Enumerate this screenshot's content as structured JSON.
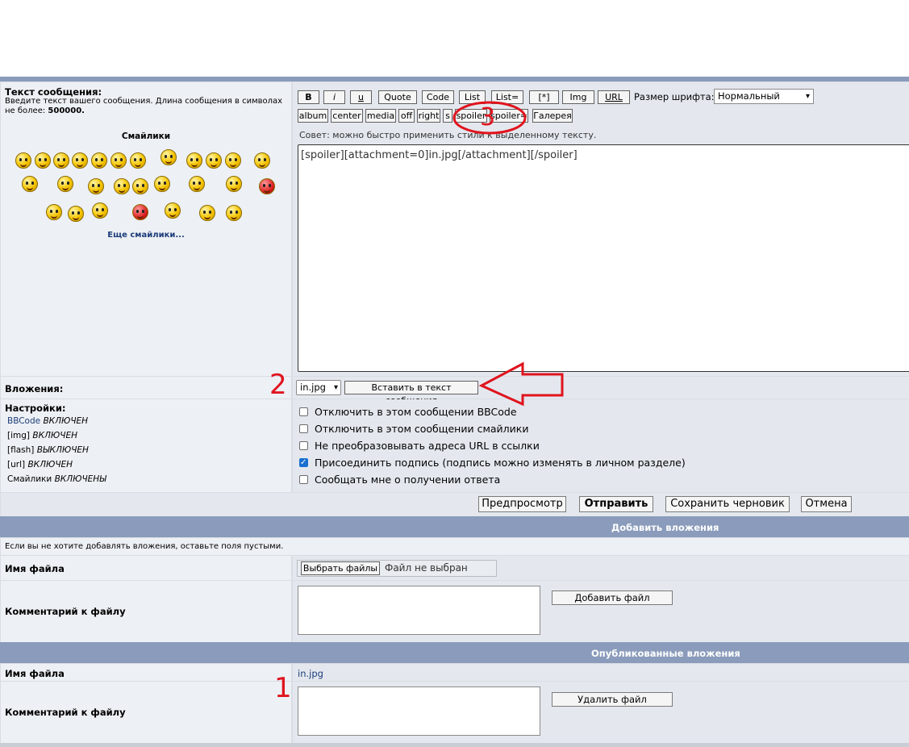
{
  "message": {
    "label": "Текст сообщения:",
    "desc": "Введите текст вашего сообщения. Длина сообщения в символах не более:",
    "max_length": "500000",
    "smilies_title": "Смайлики",
    "more_smilies": "Еще смайлики...",
    "text": "[spoiler][attachment=0]in.jpg[/attachment][/spoiler]"
  },
  "toolbar": {
    "row1": [
      "B",
      "i",
      "u",
      "Quote",
      "Code",
      "List",
      "List=",
      "[*]",
      "Img",
      "URL"
    ],
    "font_size_label": "Размер шрифта:",
    "font_size_value": "Нормальный",
    "row2": [
      "album",
      "center",
      "media",
      "off",
      "right",
      "s",
      "spoiler",
      "spoiler=",
      "Галерея"
    ],
    "hint": "Совет: можно быстро применить стили к выделенному тексту."
  },
  "attachments_row": {
    "label": "Вложения:",
    "select_value": "in.jpg",
    "insert_button": "Вставить в текст сообщения"
  },
  "settings": {
    "label": "Настройки:",
    "bbcode_link": "BBCode",
    "bbcode_status": "ВКЛЮЧЕН",
    "img_label": "[img]",
    "img_status": "ВКЛЮЧЕН",
    "flash_label": "[flash]",
    "flash_status": "ВЫКЛЮЧЕН",
    "url_label": "[url]",
    "url_status": "ВКЛЮЧЕН",
    "smilies_label": "Смайлики",
    "smilies_status": "ВКЛЮЧЕНЫ",
    "options": [
      {
        "label": "Отключить в этом сообщении BBCode",
        "checked": false
      },
      {
        "label": "Отключить в этом сообщении смайлики",
        "checked": false
      },
      {
        "label": "Не преобразовывать адреса URL в ссылки",
        "checked": false
      },
      {
        "label": "Присоединить подпись (подпись можно изменять в личном разделе)",
        "checked": true
      },
      {
        "label": "Сообщать мне о получении ответа",
        "checked": false
      }
    ]
  },
  "actions": {
    "preview": "Предпросмотр",
    "submit": "Отправить",
    "save_draft": "Сохранить черновик",
    "cancel": "Отмена"
  },
  "add_attachments": {
    "header": "Добавить вложения",
    "note": "Если вы не хотите добавлять вложения, оставьте поля пустыми.",
    "filename_label": "Имя файла",
    "choose_button": "Выбрать файлы",
    "no_file": "Файл не выбран",
    "comment_label": "Комментарий к файлу",
    "add_button": "Добавить файл"
  },
  "published": {
    "header": "Опубликованные вложения",
    "filename_label": "Имя файла",
    "filename_value": "in.jpg",
    "comment_label": "Комментарий к файлу",
    "delete_button": "Удалить файл"
  },
  "annotations": {
    "one": "1",
    "two": "2",
    "three": "3"
  },
  "colors": {
    "header_bg": "#8a9bbb",
    "annotation_red": "#e0141e",
    "link": "#1c3d7a"
  }
}
